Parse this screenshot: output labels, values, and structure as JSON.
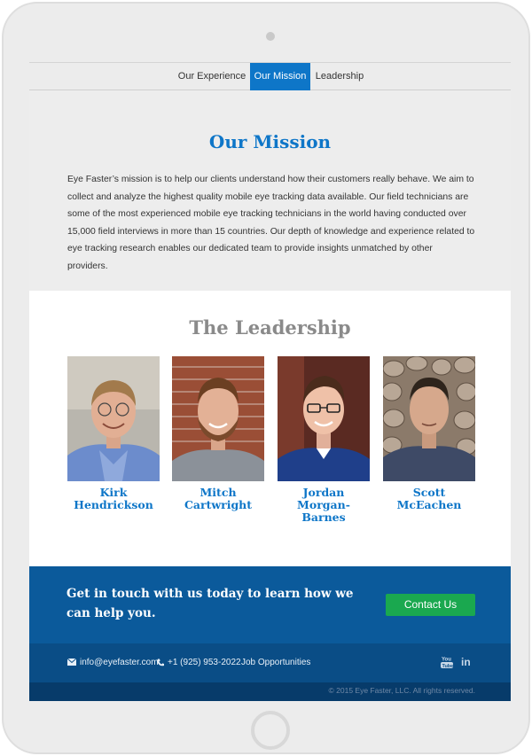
{
  "nav": {
    "items": [
      {
        "label": "Our Experience",
        "active": false
      },
      {
        "label": "Our Mission",
        "active": true
      },
      {
        "label": "Leadership",
        "active": false
      }
    ]
  },
  "mission": {
    "title": "Our Mission",
    "body": "Eye Faster’s mission is to help our clients understand how their customers really behave. We aim to collect and analyze the highest quality mobile eye tracking data available. Our field technicians are some of the most experienced mobile eye tracking technicians in the world having conducted over 15,000 field interviews in more than 15 countries. Our depth of knowledge and experience related to eye tracking research enables our dedicated team to provide insights unmatched by other providers."
  },
  "leadership": {
    "title": "The Leadership",
    "people": [
      {
        "first": "Kirk",
        "last": "Hendrickson"
      },
      {
        "first": "Mitch",
        "last": "Cartwright"
      },
      {
        "first": "Jordan",
        "last": "Morgan-Barnes"
      },
      {
        "first": "Scott",
        "last": "McEachen"
      }
    ]
  },
  "cta": {
    "text": "Get in touch with us today to learn how we can help you.",
    "button_label": "Contact Us"
  },
  "footer": {
    "email": "info@eyefaster.com",
    "phone": "+1 (925) 953-2022",
    "jobs_label": "Job Opportunities",
    "social": [
      "youtube-icon",
      "linkedin-icon"
    ],
    "copyright": "© 2015 Eye Faster, LLC. All rights reserved."
  },
  "colors": {
    "accent": "#0e76c8",
    "cta_bg": "#0b5a9b",
    "button": "#1aa84f",
    "footer": "#0a4d86",
    "copyright_bg": "#073b6a"
  }
}
